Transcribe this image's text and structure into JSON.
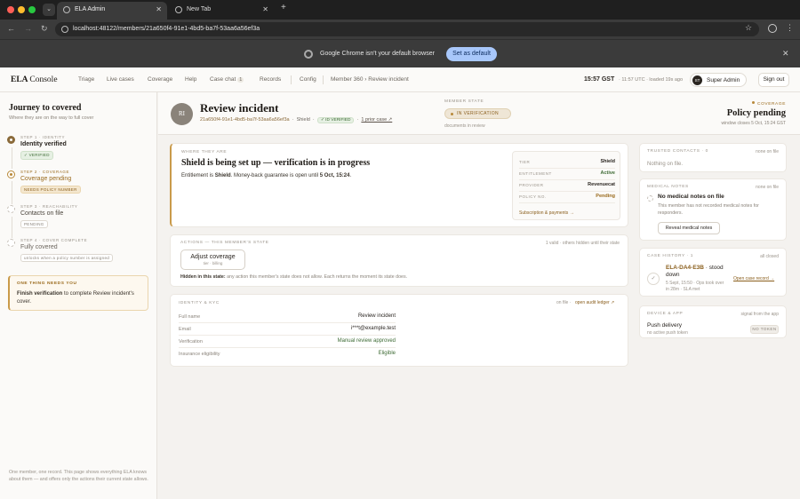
{
  "browser": {
    "tabs": [
      {
        "title": "ELA Admin"
      },
      {
        "title": "New Tab"
      }
    ],
    "url": "localhost:48122/members/21a650f4-91e1-4bd5-ba7f-53aa6a56ef3a",
    "infobar": {
      "message": "Google Chrome isn't your default browser",
      "button": "Set as default"
    }
  },
  "app": {
    "brand": {
      "name": "ELA",
      "suffix": "Console"
    },
    "nav": [
      {
        "label": "Triage"
      },
      {
        "label": "Live cases"
      },
      {
        "label": "Coverage"
      },
      {
        "label": "Help"
      },
      {
        "label": "Case chat",
        "count": "1"
      },
      {
        "label": "Records"
      },
      {
        "label": "Config"
      }
    ],
    "breadcrumb": "Member 360 › Review incident",
    "clock": "15:57 GST",
    "clock_sub": "· 11:57 UTC · loaded 19s ago",
    "user": {
      "initials": "ST",
      "name": "Super Admin"
    },
    "signout": "Sign out"
  },
  "journey": {
    "title": "Journey to covered",
    "subtitle": "Where they are on the way to full cover",
    "steps": [
      {
        "label": "STEP 1 · IDENTITY",
        "name": "Identity verified",
        "tag": "✓ VERIFIED"
      },
      {
        "label": "STEP 2 · COVERAGE",
        "name": "Coverage pending",
        "tag": "NEEDS POLICY NUMBER"
      },
      {
        "label": "STEP 3 · REACHABILITY",
        "name": "Contacts on file",
        "tag": "PENDING"
      },
      {
        "label": "STEP 4 · COVER COMPLETE",
        "name": "Fully covered",
        "tag": "unlocks when a policy number is assigned"
      }
    ],
    "one_thing": {
      "heading": "ONE THING NEEDS YOU",
      "action": "Finish verification",
      "rest": " to complete Review incident's cover."
    },
    "footer": "One member, one record. This page shows everything ELA knows about them — and offers only the actions their current state allows."
  },
  "member": {
    "initials": "RI",
    "name": "Review incident",
    "uuid": "21a650f4-91e1-4bd5-ba7f-53aa6a56ef3a",
    "tier": "Shield",
    "id_badge": "✓ ID VERIFIED",
    "prior_case": "1 prior case ↗",
    "state_label": "MEMBER STATE",
    "state": "IN VERIFICATION",
    "state_sub": "documents in review",
    "coverage_label": "COVERAGE",
    "coverage_status": "Policy pending",
    "coverage_sub": "window closes 5 Oct, 15:24 GST"
  },
  "where_they_are": {
    "caption": "WHERE THEY ARE",
    "headline": "Shield is being set up — verification is in progress",
    "body_pre": "Entitlement is ",
    "body_tier": "Shield",
    "body_mid": ". Money-back guarantee is open until ",
    "body_date": "5 Oct, 15:24",
    "body_end": ".",
    "entitlement": [
      {
        "key": "TIER",
        "value": "Shield"
      },
      {
        "key": "ENTITLEMENT",
        "value": "Active"
      },
      {
        "key": "PROVIDER",
        "value": "Revenuecat"
      },
      {
        "key": "POLICY NO.",
        "value": "Pending"
      }
    ],
    "link": "Subscription & payments →"
  },
  "actions": {
    "caption": "ACTIONS — THIS MEMBER'S STATE",
    "right": "1 valid · others hidden until their state",
    "button": {
      "label": "Adjust coverage",
      "sub": "tier · billing"
    },
    "hidden_label": "Hidden in this state:",
    "hidden_text": " any action this member's state does not allow. Each returns the moment its state does."
  },
  "identity": {
    "caption": "IDENTITY & KYC",
    "on_file": "on file ·",
    "ledger": "open audit ledger ↗",
    "rows": [
      {
        "key": "Full name",
        "value": "Review incident"
      },
      {
        "key": "Email",
        "value": "i***t@example.test"
      },
      {
        "key": "Verification",
        "value": "Manual review approved"
      },
      {
        "key": "Insurance eligibility",
        "value": "Eligible"
      }
    ]
  },
  "trusted": {
    "caption": "TRUSTED CONTACTS · 0",
    "right": "none on file",
    "empty": "Nothing on file."
  },
  "medical": {
    "caption": "MEDICAL NOTES",
    "right": "none on file",
    "heading": "No medical notes on file",
    "body": "This member has not recorded medical notes for responders.",
    "button": "Reveal medical notes"
  },
  "case_history": {
    "caption": "CASE HISTORY · 1",
    "right": "all closed",
    "case_id": "ELA-DA4-E3B",
    "case_status": " · stood down",
    "case_sub": "5 Sept, 15:50 · Ops took over in 28m · SLA met",
    "open": "Open case record →"
  },
  "device": {
    "caption": "DEVICE & APP",
    "right": "signal from the app",
    "heading": "Push delivery",
    "sub": "no active push token",
    "badge": "NO TOKEN"
  },
  "colors": {
    "accent": "#b8893a",
    "verified": "#3e6b35",
    "chrome_dark": "#3b3b3b",
    "button_blue": "#a8c7fa"
  },
  "icons": {
    "tab": "globe-icon",
    "back": "back-arrow-icon",
    "forward": "forward-arrow-icon",
    "reload": "reload-icon",
    "bookmark": "star-icon",
    "menu": "kebab-icon"
  }
}
